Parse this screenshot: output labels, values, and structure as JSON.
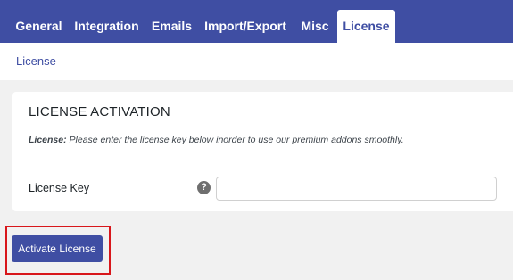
{
  "tabs": [
    {
      "label": "General",
      "active": false
    },
    {
      "label": "Integration",
      "active": false
    },
    {
      "label": "Emails",
      "active": false
    },
    {
      "label": "Import/Export",
      "active": false
    },
    {
      "label": "Misc",
      "active": false
    },
    {
      "label": "License",
      "active": true
    }
  ],
  "subnav": {
    "link": "License"
  },
  "panel": {
    "title": "LICENSE ACTIVATION",
    "desc_prefix": "License:",
    "desc_text": "Please enter the license key below inorder to use our premium addons smoothly.",
    "field_label": "License Key",
    "help_icon": "question-mark-icon",
    "key_value": ""
  },
  "actions": {
    "activate_label": "Activate License"
  },
  "colors": {
    "brand": "#3f4ea3",
    "highlight": "#d8161b"
  }
}
